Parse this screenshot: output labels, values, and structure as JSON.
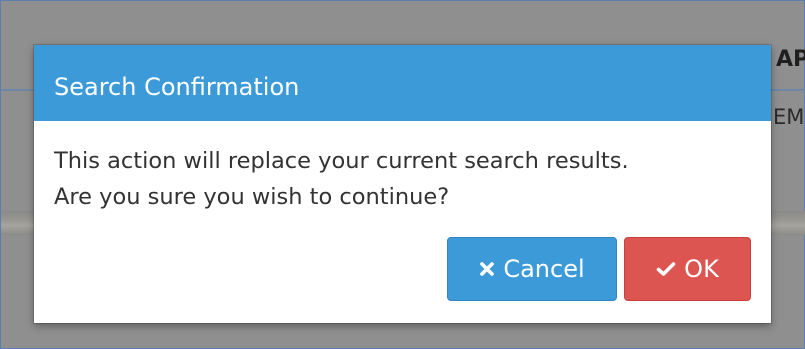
{
  "background": {
    "fragment_top": "AP",
    "fragment_mid": "EM"
  },
  "dialog": {
    "title": "Search Confirmation",
    "message_line1": "This action will replace your current search results.",
    "message_line2": "Are you sure you wish to continue?",
    "cancel_label": "Cancel",
    "cancel_icon": "close-x-icon",
    "ok_label": "OK",
    "ok_icon": "checkmark-icon"
  },
  "colors": {
    "header": "#3d9ad8",
    "cancel_button": "#3d9ad8",
    "ok_button": "#dc5551",
    "backdrop": "#8f8f8f"
  }
}
